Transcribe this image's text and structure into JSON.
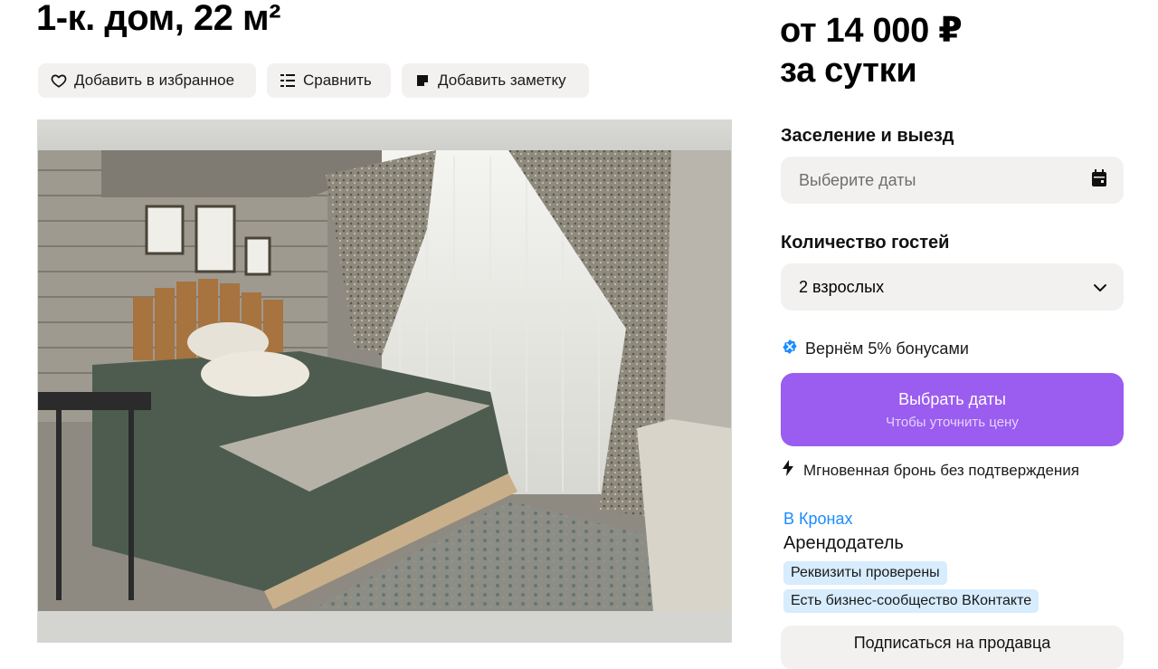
{
  "listing": {
    "title": "1-к. дом, 22 м²"
  },
  "actions": {
    "favorite_label": "Добавить в избранное",
    "favorite_icon": "heart-icon",
    "compare_label": "Сравнить",
    "compare_icon": "compare-list-icon",
    "note_label": "Добавить заметку",
    "note_icon": "note-icon"
  },
  "photo": {
    "subject": "bedroom-photo"
  },
  "pricing": {
    "price_line": "от 14 000 ₽",
    "period_line": "за сутки"
  },
  "booking": {
    "checkin_label": "Заселение и выезд",
    "dates_placeholder": "Выберите даты",
    "dates_icon": "calendar-icon",
    "guests_label": "Количество гостей",
    "guests_value": "2 взрослых",
    "guests_icon": "chevron-down-icon",
    "bonus_text": "Вернём 5% бонусами",
    "bonus_icon": "bonus-badge-icon",
    "cta_label": "Выбрать даты",
    "cta_sublabel": "Чтобы уточнить цену",
    "instant_text": "Мгновенная бронь без подтверждения",
    "instant_icon": "lightning-icon"
  },
  "seller": {
    "name": "В Кронах",
    "role": "Арендодатель",
    "badges": [
      "Реквизиты проверены",
      "Есть бизнес-сообщество ВКонтакте"
    ],
    "subscribe_label": "Подписаться на продавца"
  },
  "colors": {
    "accent": "#9b5cf0",
    "link": "#1a8cff",
    "badge_bg": "#d7ecfd",
    "field_bg": "#f2f1f0"
  }
}
